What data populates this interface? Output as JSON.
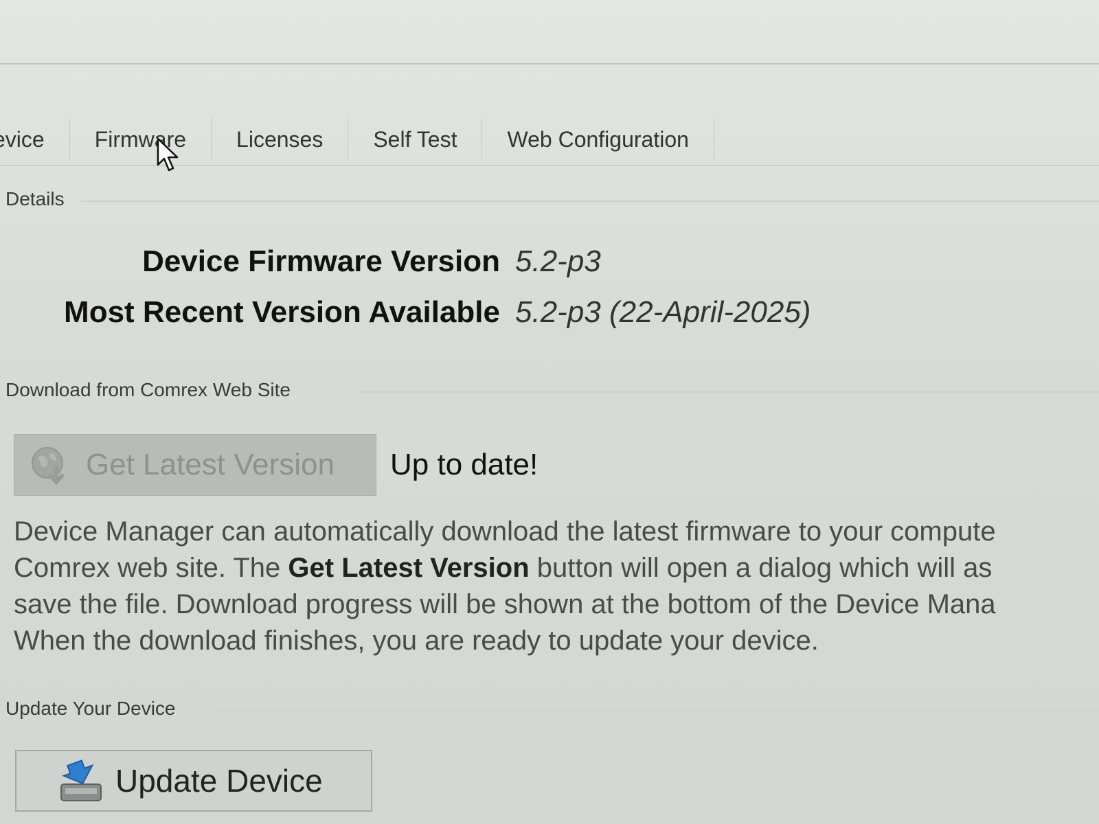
{
  "tabs": [
    {
      "label": "evice"
    },
    {
      "label": "Firmware"
    },
    {
      "label": "Licenses"
    },
    {
      "label": "Self Test"
    },
    {
      "label": "Web Configuration"
    }
  ],
  "active_tab": "Firmware",
  "details": {
    "group_label": "Details",
    "rows": [
      {
        "label": "Device Firmware Version",
        "value": "5.2-p3"
      },
      {
        "label": "Most Recent Version Available",
        "value": "5.2-p3 (22-April-2025)"
      }
    ]
  },
  "download": {
    "group_label": "Download from Comrex Web Site",
    "button_label": "Get Latest Version",
    "button_icon": "globe-download-icon",
    "status_text": "Up to date!",
    "description_lines": [
      {
        "pre": "Device Manager can automatically download the latest firmware to your compute",
        "bold": "",
        "post": ""
      },
      {
        "pre": "Comrex web site. The ",
        "bold": "Get Latest Version",
        "post": " button will open a dialog which will as"
      },
      {
        "pre": "save the file. Download progress will be shown at the bottom of the Device Mana",
        "bold": "",
        "post": ""
      },
      {
        "pre": "When the download finishes, you are ready to update your device.",
        "bold": "",
        "post": ""
      }
    ]
  },
  "update": {
    "group_label": "Update Your Device",
    "button_label": "Update Device",
    "button_icon": "update-device-icon"
  },
  "colors": {
    "background": "#dcdedb",
    "disabled_button": "#b9bbb8",
    "disabled_text": "#8f918e",
    "update_icon_blue": "#2f7fd0"
  }
}
